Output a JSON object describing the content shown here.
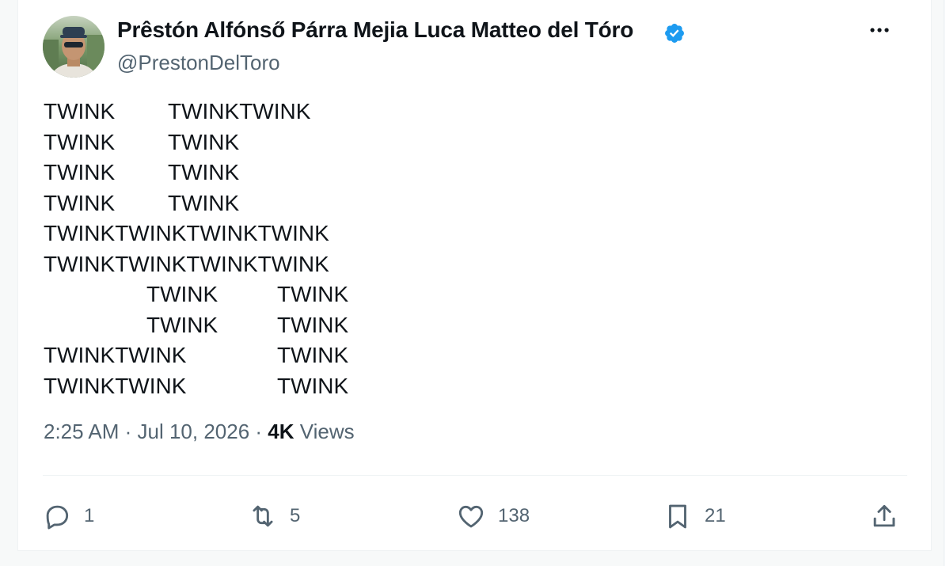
{
  "author": {
    "display_name": "Prêstón Alfónső Párra Mejia Luca Matteo del Tóro",
    "handle": "@PrestonDelToro",
    "verified": true,
    "verified_color": "#1d9bf0"
  },
  "tweet": {
    "lines": [
      [
        "TWINK",
        "TWINKTWINK"
      ],
      [
        "TWINK",
        "TWINK"
      ],
      [
        "TWINK",
        "TWINK"
      ],
      [
        "TWINK",
        "TWINK"
      ],
      [
        "TWINKTWINKTWINKTWINK"
      ],
      [
        "TWINKTWINKTWINKTWINK"
      ],
      [
        "TWINK",
        "TWINK"
      ],
      [
        "TWINK",
        "TWINK"
      ],
      [
        "TWINKTWINK",
        "TWINK"
      ],
      [
        "TWINKTWINK",
        "TWINK"
      ]
    ]
  },
  "meta": {
    "time": "2:25 AM",
    "separator": " · ",
    "date": "Jul 10, 2026",
    "views_count": "4K",
    "views_label": " Views"
  },
  "actions": {
    "replies": "1",
    "reposts": "5",
    "likes": "138",
    "bookmarks": "21"
  },
  "icons": {
    "more": "more-horizontal-icon",
    "reply": "reply-icon",
    "repost": "repost-icon",
    "like": "heart-icon",
    "bookmark": "bookmark-icon",
    "share": "share-icon",
    "verified": "verified-badge-icon"
  },
  "colors": {
    "text": "#0f1419",
    "secondary": "#536471",
    "border": "#eff3f4"
  }
}
